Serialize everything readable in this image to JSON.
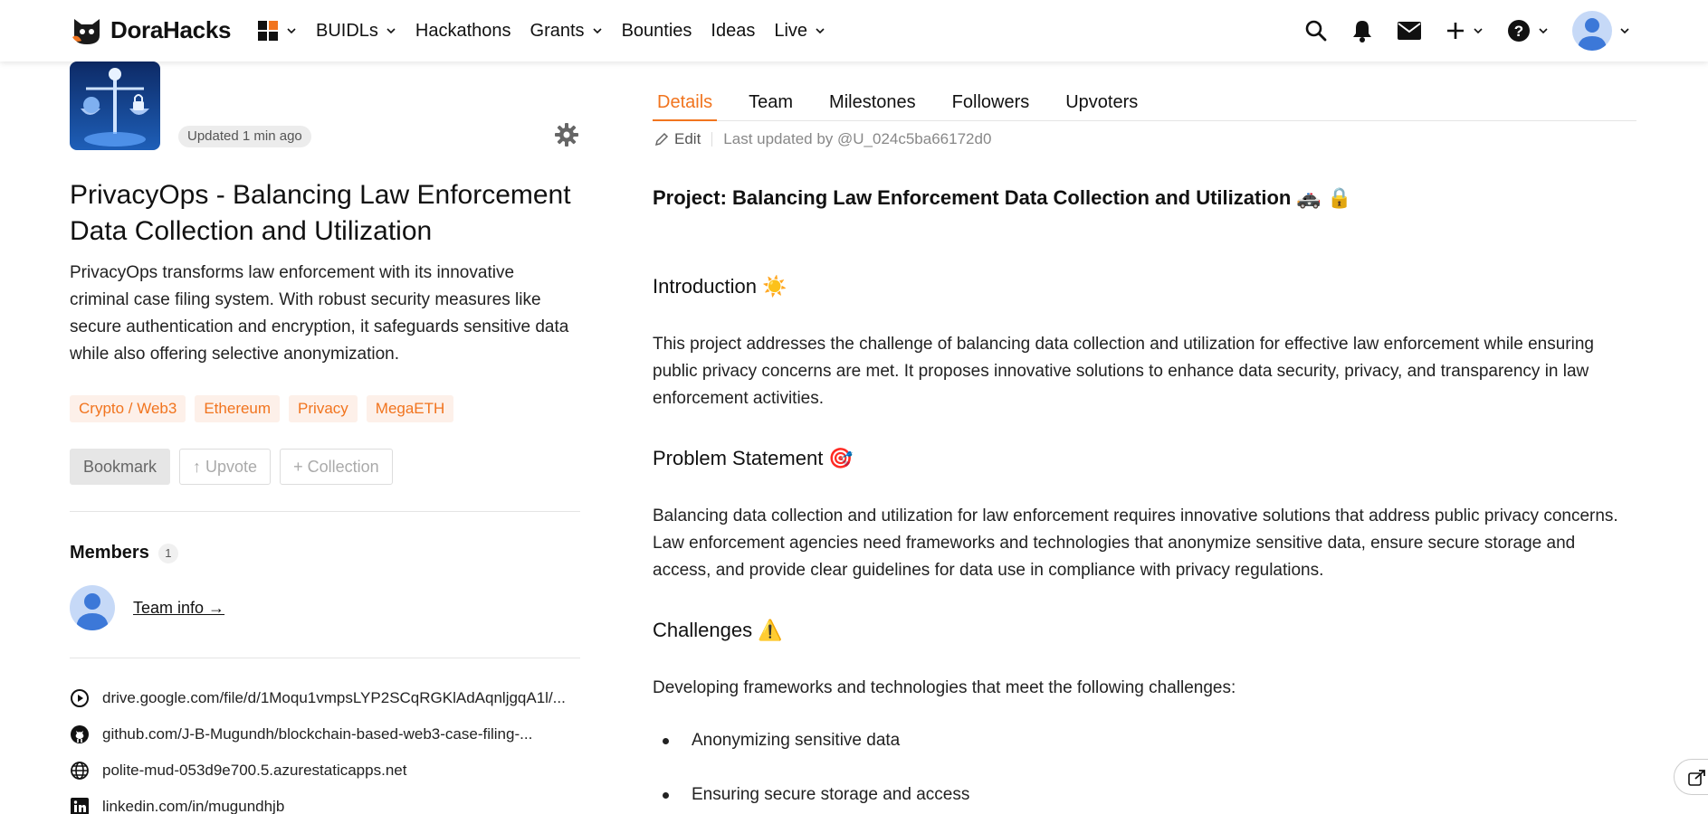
{
  "nav": {
    "brand": "DoraHacks",
    "items": [
      "BUIDLs",
      "Hackathons",
      "Grants",
      "Bounties",
      "Ideas",
      "Live"
    ]
  },
  "project": {
    "updated": "Updated 1 min ago",
    "title": "PrivacyOps - Balancing Law Enforcement Data Collection and Utilization",
    "description": "PrivacyOps transforms law enforcement with its innovative criminal case filing system. With robust security measures like secure authentication and encryption, it safeguards sensitive data while also offering selective anonymization.",
    "tags": [
      "Crypto / Web3",
      "Ethereum",
      "Privacy",
      "MegaETH"
    ],
    "actions": {
      "bookmark": "Bookmark",
      "upvote": "↑ Upvote",
      "collection": "+ Collection"
    }
  },
  "members": {
    "label": "Members",
    "count": "1",
    "team_info": "Team info →"
  },
  "links": [
    {
      "icon": "play-circle-icon",
      "text": "drive.google.com/file/d/1Moqu1vmpsLYP2SCqRGKlAdAqnljgqA1l/..."
    },
    {
      "icon": "github-icon",
      "text": "github.com/J-B-Mugundh/blockchain-based-web3-case-filing-..."
    },
    {
      "icon": "globe-icon",
      "text": "polite-mud-053d9e700.5.azurestaticapps.net"
    },
    {
      "icon": "linkedin-icon",
      "text": "linkedin.com/in/mugundhjb"
    }
  ],
  "tabs": [
    "Details",
    "Team",
    "Milestones",
    "Followers",
    "Upvoters"
  ],
  "edit": {
    "label": "Edit",
    "last_updated": "Last updated by @U_024c5ba66172d0"
  },
  "details": {
    "heading": "Project: Balancing Law Enforcement Data Collection and Utilization 🚓 🔒",
    "intro_h": "Introduction ☀️",
    "intro_p": "This project addresses the challenge of balancing data collection and utilization for effective law enforcement while ensuring public privacy concerns are met. It proposes innovative solutions to enhance data security, privacy, and transparency in law enforcement activities.",
    "problem_h": "Problem Statement 🎯",
    "problem_p": "Balancing data collection and utilization for law enforcement requires innovative solutions that address public privacy concerns. Law enforcement agencies need frameworks and technologies that anonymize sensitive data, ensure secure storage and access, and provide clear guidelines for data use in compliance with privacy regulations.",
    "challenges_h": "Challenges ⚠️",
    "challenges_p": "Developing frameworks and technologies that meet the following challenges:",
    "bullets": [
      "Anonymizing sensitive data",
      "Ensuring secure storage and access"
    ]
  },
  "colors": {
    "accent": "#f1741e",
    "tag_bg": "#fdf0e9",
    "avatar": "#c6d9f7",
    "avatar_fg": "#3c78d8"
  }
}
